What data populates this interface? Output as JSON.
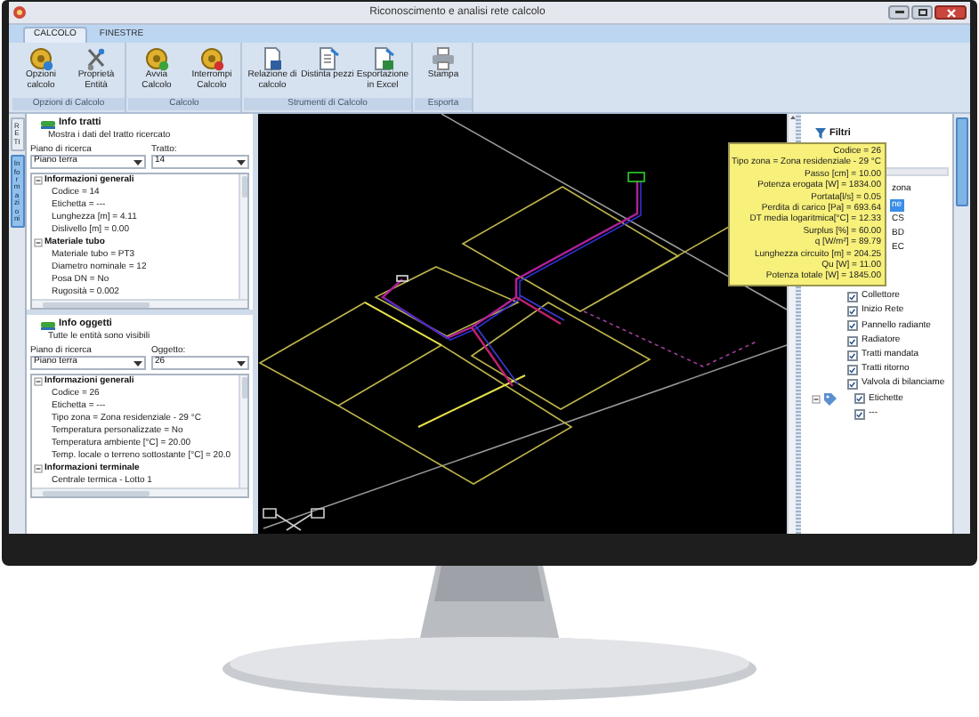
{
  "window": {
    "title": "Riconoscimento e analisi rete calcolo"
  },
  "tabs": [
    {
      "label": "CALCOLO",
      "selected": true
    },
    {
      "label": "FINESTRE",
      "selected": false
    }
  ],
  "ribbon": {
    "groups": [
      {
        "label": "Opzioni di Calcolo",
        "buttons": [
          {
            "label": "Opzioni calcolo"
          },
          {
            "label": "Proprietà Entità"
          }
        ]
      },
      {
        "label": "Calcolo",
        "buttons": [
          {
            "label": "Avvia Calcolo"
          },
          {
            "label": "Interrompi Calcolo"
          }
        ]
      },
      {
        "label": "Strumenti di Calcolo",
        "buttons": [
          {
            "label": "Relazione di calcolo"
          },
          {
            "label": "Distinta pezzi"
          },
          {
            "label": "Esportazione in Excel"
          }
        ]
      },
      {
        "label": "Esporta",
        "buttons": [
          {
            "label": "Stampa"
          }
        ]
      }
    ]
  },
  "side_tabs": [
    {
      "label": "RETI",
      "selected": false
    },
    {
      "label": "Informazioni",
      "selected": true
    }
  ],
  "panels": [
    {
      "title": "Info tratti",
      "description": "Mostra i dati del tratto ricercato",
      "fields": [
        {
          "label": "Piano di ricerca",
          "value": "Piano terra"
        },
        {
          "label": "Tratto:",
          "value": "14"
        }
      ],
      "groups": [
        {
          "label": "Informazioni generali",
          "expanded": true,
          "rows": [
            "Codice = 14",
            "Etichetta = ---",
            "Lunghezza [m] = 4.11",
            "Dislivello [m] = 0.00"
          ]
        },
        {
          "label": "Materiale tubo",
          "expanded": true,
          "rows": [
            "Materiale tubo = PT3",
            "Diametro nominale = 12",
            "Posa DN = No",
            "Rugosità = 0.002"
          ]
        }
      ]
    },
    {
      "title": "Info oggetti",
      "description": "Tutte le entità sono visibili",
      "fields": [
        {
          "label": "Piano di ricerca",
          "value": "Piano terra"
        },
        {
          "label": "Oggetto:",
          "value": "26"
        }
      ],
      "groups": [
        {
          "label": "Informazioni generali",
          "expanded": true,
          "rows": [
            "Codice = 26",
            "Etichetta = ---",
            "Tipo zona = Zona residenziale - 29 °C",
            "Temperatura personalizzate = No",
            "Temperatura ambiente [°C] = 20.00",
            "Temp. locale o terreno sottostante [°C] = 20.0"
          ]
        },
        {
          "label": "Informazioni terminale",
          "expanded": true,
          "rows": [
            "Centrale termica - Lotto 1"
          ]
        }
      ]
    }
  ],
  "filters": {
    "title": "Filtri",
    "items": [
      {
        "kind": "partial",
        "label": "zona",
        "selected": false
      },
      {
        "kind": "partial",
        "label": "ne",
        "selected": true
      },
      {
        "kind": "partial",
        "label": "CS",
        "selected": false
      },
      {
        "kind": "partial",
        "label": "BD",
        "selected": false
      },
      {
        "kind": "partial",
        "label": "EC",
        "selected": false
      },
      {
        "kind": "check",
        "label": "Collettore",
        "checked": true,
        "selected": false
      },
      {
        "kind": "check",
        "label": "Inizio Rete",
        "checked": true,
        "selected": false
      },
      {
        "kind": "check",
        "label": "Pannello radiante",
        "checked": true,
        "selected": false
      },
      {
        "kind": "check",
        "label": "Radiatore",
        "checked": true,
        "selected": false
      },
      {
        "kind": "check",
        "label": "Tratti mandata",
        "checked": true,
        "selected": false
      },
      {
        "kind": "check",
        "label": "Tratti ritorno",
        "checked": true,
        "selected": false
      },
      {
        "kind": "check",
        "label": "Valvola di bilanciame",
        "checked": true,
        "selected": false
      },
      {
        "kind": "group",
        "label": "Etichette",
        "checked": true,
        "expanded": true,
        "selected": false,
        "children": [
          {
            "kind": "check",
            "label": "---",
            "checked": true,
            "selected": false
          }
        ]
      }
    ]
  },
  "tooltip": {
    "lines": [
      "Codice = 26",
      "Tipo zona = Zona residenziale - 29 °C",
      "Passo [cm] = 10.00",
      "Potenza erogata [W] = 1834.00",
      "Portata[l/s] = 0.05",
      "Perdita di carico [Pa] = 693.64",
      "DT media logaritmica[°C] = 12.33",
      "Surplus [%] = 60.00",
      "q [W/m²] = 89.79",
      "Lunghezza circuito [m] = 204.25",
      "Qu [W] = 11.00",
      "Potenza totale [W] = 1845.00"
    ]
  }
}
